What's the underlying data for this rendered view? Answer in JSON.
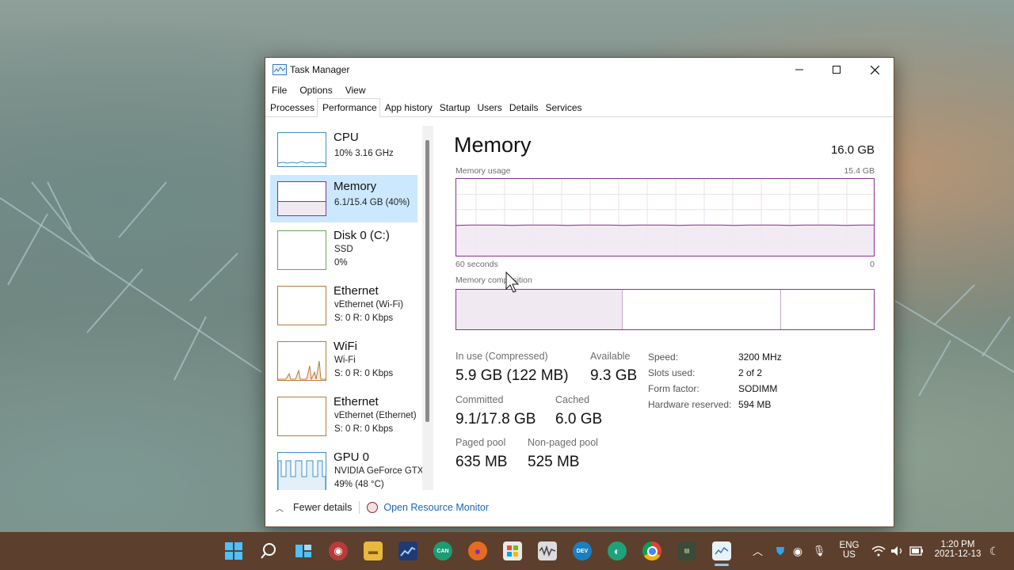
{
  "window": {
    "title": "Task Manager"
  },
  "menu": [
    "File",
    "Options",
    "View"
  ],
  "tabs": [
    "Processes",
    "Performance",
    "App history",
    "Startup",
    "Users",
    "Details",
    "Services"
  ],
  "sidebar": [
    {
      "name": "CPU",
      "line1": "10%  3.16 GHz",
      "line2": ""
    },
    {
      "name": "Memory",
      "line1": "6.1/15.4 GB (40%)",
      "line2": ""
    },
    {
      "name": "Disk 0 (C:)",
      "line1": "SSD",
      "line2": "0%"
    },
    {
      "name": "Ethernet",
      "line1": "vEthernet (Wi-Fi)",
      "line2": "S: 0  R: 0 Kbps"
    },
    {
      "name": "WiFi",
      "line1": "Wi-Fi",
      "line2": "S: 0  R: 0 Kbps"
    },
    {
      "name": "Ethernet",
      "line1": "vEthernet (Ethernet)",
      "line2": "S: 0  R: 0 Kbps"
    },
    {
      "name": "GPU 0",
      "line1": "NVIDIA GeForce GTX",
      "line2": "49% (48 °C)"
    }
  ],
  "main": {
    "title": "Memory",
    "total": "16.0 GB",
    "usage_label": "Memory usage",
    "usage_max": "15.4 GB",
    "time_left": "60 seconds",
    "time_right": "0",
    "composition_label": "Memory composition",
    "usage_percent": 40
  },
  "stats": {
    "in_use_label": "In use (Compressed)",
    "in_use": "5.9 GB (122 MB)",
    "available_label": "Available",
    "available": "9.3 GB",
    "committed_label": "Committed",
    "committed": "9.1/17.8 GB",
    "cached_label": "Cached",
    "cached": "6.0 GB",
    "paged_label": "Paged pool",
    "paged": "635 MB",
    "nonpaged_label": "Non-paged pool",
    "nonpaged": "525 MB"
  },
  "props": [
    {
      "label": "Speed:",
      "value": "3200 MHz"
    },
    {
      "label": "Slots used:",
      "value": "2 of 2"
    },
    {
      "label": "Form factor:",
      "value": "SODIMM"
    },
    {
      "label": "Hardware reserved:",
      "value": "594 MB"
    }
  ],
  "footer": {
    "fewer": "Fewer details",
    "monitor": "Open Resource Monitor"
  },
  "tray": {
    "lang1": "ENG",
    "lang2": "US",
    "time": "1:20 PM",
    "date": "2021-12-13"
  },
  "colors": {
    "accent": "#8b2f8f",
    "selection": "#cce8ff",
    "taskbar": "#5d3f2d",
    "link": "#1a66b5"
  }
}
